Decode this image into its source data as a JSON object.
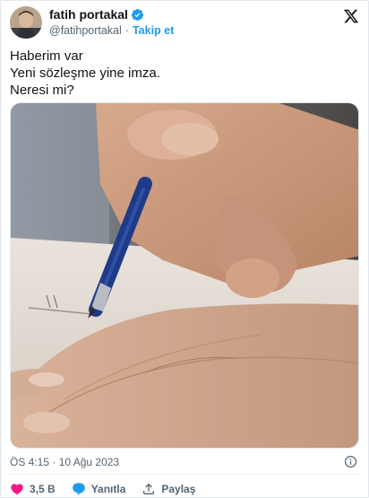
{
  "author": {
    "display_name": "fatih portakal",
    "handle": "@fatihportakal",
    "separator": "·",
    "follow_label": "Takip et"
  },
  "tweet": {
    "lines": [
      "Haberim var",
      "Yeni sözleşme yine imza.",
      "Neresi mi?"
    ],
    "timestamp": "ÖS 4:15 · 10 Ağu 2023"
  },
  "actions": {
    "like_count": "3,5 B",
    "reply_label": "Yanıtla",
    "share_label": "Paylaş"
  },
  "icons": {
    "verified": "verified-badge-icon",
    "brand": "x-logo-icon",
    "info": "info-icon",
    "like": "heart-icon",
    "reply": "chat-bubble-icon",
    "share": "share-upload-icon"
  },
  "colors": {
    "accent": "#1d9bf0",
    "like": "#f91880",
    "text": "#0f1419",
    "muted": "#536471"
  }
}
